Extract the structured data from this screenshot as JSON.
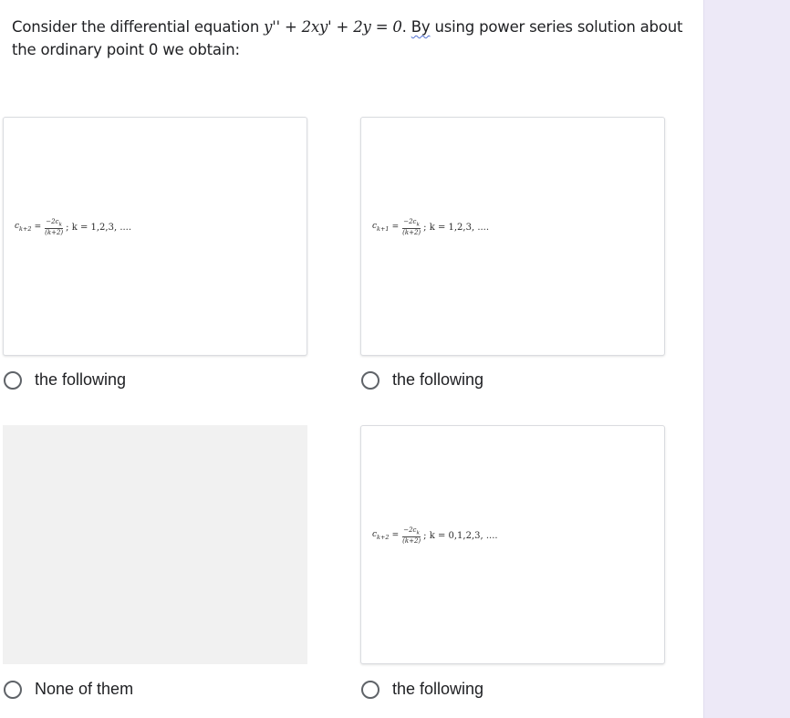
{
  "question": {
    "text_before": "Consider the differential equation ",
    "equation": "y'' + 2xy' + 2y = 0",
    "text_after": ". ",
    "underlined_word": "By",
    "text_rest": " using power series solution about the ordinary point 0 we obtain:"
  },
  "options": [
    {
      "formula": {
        "lhs": "c",
        "lhs_sub": "k+2",
        "numerator": "−2c",
        "numerator_sub": "k",
        "denominator": "(k+2)",
        "condition": "k = 1,2,3, ...."
      },
      "label": "the following"
    },
    {
      "formula": {
        "lhs": "c",
        "lhs_sub": "k+1",
        "numerator": "−2c",
        "numerator_sub": "k",
        "denominator": "(k+2)",
        "condition": "k = 1,2,3, ...."
      },
      "label": "the following"
    },
    {
      "formula": null,
      "label": "None of them"
    },
    {
      "formula": {
        "lhs": "c",
        "lhs_sub": "k+2",
        "numerator": "−2c",
        "numerator_sub": "k",
        "denominator": "(k+2)",
        "condition": "k = 0,1,2,3, ...."
      },
      "label": "the following"
    }
  ]
}
